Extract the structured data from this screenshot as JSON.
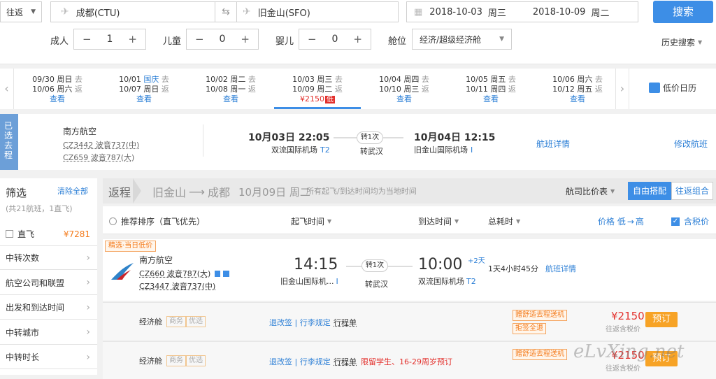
{
  "search": {
    "trip_type": "往返",
    "from": "成都(CTU)",
    "to": "旧金山(SFO)",
    "depart_date": "2018-10-03",
    "depart_weekday": "周三",
    "return_date": "2018-10-09",
    "return_weekday": "周二",
    "search_label": "搜索"
  },
  "passengers": {
    "adult_label": "成人",
    "adult": "1",
    "child_label": "儿童",
    "child": "0",
    "infant_label": "婴儿",
    "infant": "0",
    "cabin_label": "舱位",
    "cabin": "经济/超级经济舱",
    "history": "历史搜索"
  },
  "date_strip": [
    {
      "d1": "09/30",
      "w1": "周日",
      "t1": "去",
      "d2": "10/06",
      "w2": "周六",
      "t2": "返",
      "price": "查看"
    },
    {
      "d1": "10/01",
      "w1": "国庆",
      "t1": "去",
      "d2": "10/07",
      "w2": "周日",
      "t2": "返",
      "price": "查看"
    },
    {
      "d1": "10/02",
      "w1": "周二",
      "t1": "去",
      "d2": "10/08",
      "w2": "周一",
      "t2": "返",
      "price": "查看"
    },
    {
      "d1": "10/03",
      "w1": "周三",
      "t1": "去",
      "d2": "10/09",
      "w2": "周二",
      "t2": "返",
      "price": "¥2150",
      "low": "低"
    },
    {
      "d1": "10/04",
      "w1": "周四",
      "t1": "去",
      "d2": "10/10",
      "w2": "周三",
      "t2": "返",
      "price": "查看"
    },
    {
      "d1": "10/05",
      "w1": "周五",
      "t1": "去",
      "d2": "10/11",
      "w2": "周四",
      "t2": "返",
      "price": "查看"
    },
    {
      "d1": "10/06",
      "w1": "周六",
      "t1": "去",
      "d2": "10/12",
      "w2": "周五",
      "t2": "返",
      "price": "查看"
    }
  ],
  "calendar_label": "低价日历",
  "selected": {
    "tag": "已选去程",
    "airline": "南方航空",
    "f1": "CZ3442 波音737(中)",
    "f2": "CZ659 波音787(大)",
    "dep_time": "10月03日 22:05",
    "dep_airport": "双流国际机场",
    "dep_term": "T2",
    "transfer": "转1次",
    "via": "转武汉",
    "arr_time": "10月04日 12:15",
    "arr_airport": "旧金山国际机场",
    "arr_term": "I",
    "detail": "航班详情",
    "modify": "修改航班"
  },
  "filter": {
    "title": "筛选",
    "clear": "清除全部",
    "summary": "(共21航班，1直飞)",
    "direct": "直飞",
    "direct_price": "¥7281",
    "items": [
      "中转次数",
      "航空公司和联盟",
      "出发和到达时间",
      "中转城市",
      "中转时长"
    ]
  },
  "return_header": {
    "label": "返程",
    "route_from": "旧金山",
    "route_to": "成都",
    "date": "10月09日 周二",
    "note": "所有起飞/到达时间均为当地时间",
    "compare": "航司比价表",
    "free": "自由搭配",
    "combo": "往返组合"
  },
  "sort": {
    "recommend": "推荐排序（直飞优先）",
    "dep": "起飞时间",
    "arr": "到达时间",
    "dur": "总耗时",
    "price": "价格 低",
    "price_arrow": "高",
    "tax": "含税价"
  },
  "flight": {
    "badge": "精选·当日低价",
    "airline": "南方航空",
    "f1": "CZ660 波音787(大)",
    "f2": "CZ3447 波音737(中)",
    "dep": "14:15",
    "dep_airport": "旧金山国际机...",
    "dep_term": "I",
    "transfer": "转1次",
    "via": "转武汉",
    "arr": "10:00",
    "plus": "+2天",
    "arr_airport": "双流国际机场",
    "arr_term": "T2",
    "duration": "1天4小时45分",
    "detail": "航班详情"
  },
  "fares": [
    {
      "cabin": "经济舱",
      "tag1": "商务",
      "tag2": "优选",
      "links": "退改签 | 行李规定",
      "itin": "行程单",
      "note": "",
      "badge1": "赠舒适去程送机",
      "badge2": "拒签全退",
      "price": "¥2150",
      "sub": "往返含税价",
      "book": "预订"
    },
    {
      "cabin": "经济舱",
      "tag1": "商务",
      "tag2": "优选",
      "links": "退改签 | 行李规定",
      "itin": "行程单",
      "note": "限留学生、16-29周岁预订",
      "badge1": "赠舒适去程送机",
      "badge2": "",
      "price": "¥2150",
      "sub": "往返含税价",
      "book": "预订"
    }
  ],
  "watermark": "eLvXing.net"
}
